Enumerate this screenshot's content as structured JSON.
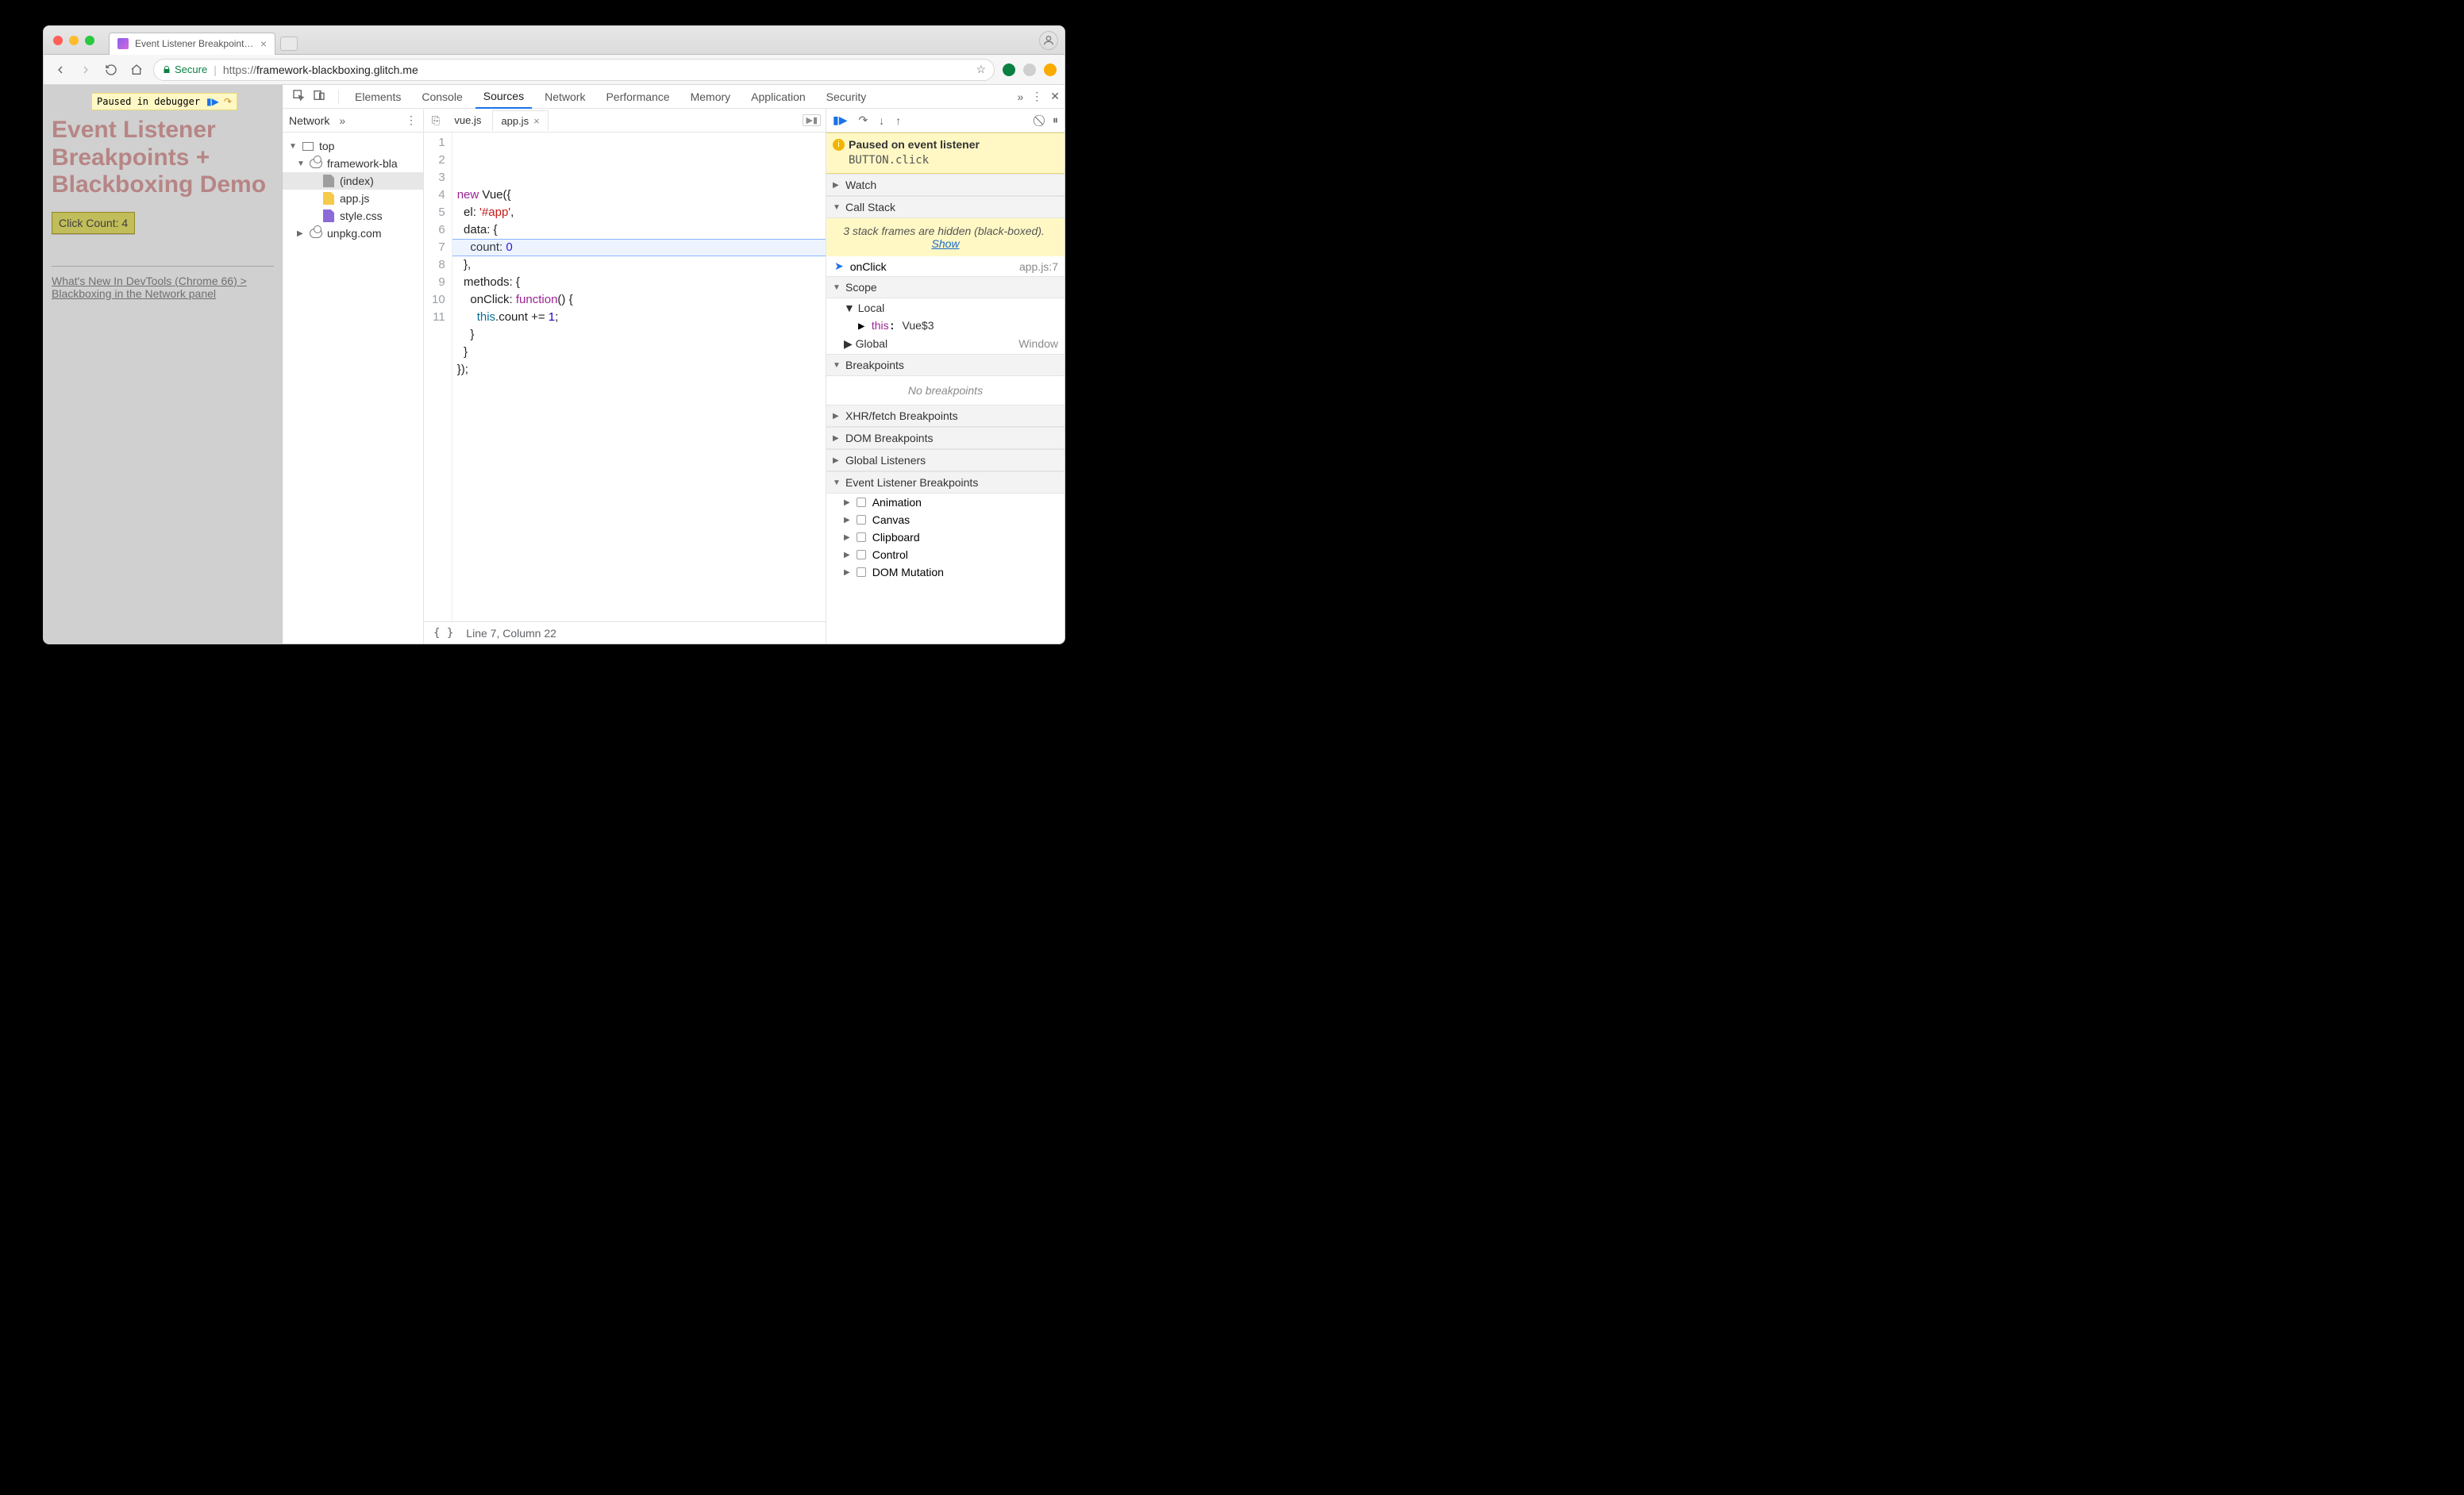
{
  "browser": {
    "tab_title": "Event Listener Breakpoints + B",
    "secure_label": "Secure",
    "url_scheme": "https://",
    "url_host": "framework-blackboxing.glitch.me"
  },
  "page": {
    "paused_label": "Paused in debugger",
    "heading": "Event Listener Breakpoints + Blackboxing Demo",
    "button_label": "Click Count: 4",
    "doc_link": "What's New In DevTools (Chrome 66) > Blackboxing in the Network panel"
  },
  "devtools": {
    "tabs": [
      "Elements",
      "Console",
      "Sources",
      "Network",
      "Performance",
      "Memory",
      "Application",
      "Security"
    ],
    "active_tab": "Sources",
    "navigator": {
      "tab_label": "Network",
      "tree": {
        "top": "top",
        "domain": "framework-bla",
        "files": [
          "(index)",
          "app.js",
          "style.css"
        ],
        "external": "unpkg.com"
      }
    },
    "editor": {
      "open_tabs": [
        "vue.js",
        "app.js"
      ],
      "active_tab": "app.js",
      "highlight_line": 7,
      "code_lines": [
        "new Vue({",
        "  el: '#app',",
        "  data: {",
        "    count: 0",
        "  },",
        "  methods: {",
        "    onClick: function() {",
        "      this.count += 1;",
        "    }",
        "  }",
        "});"
      ],
      "status": "Line 7, Column 22"
    },
    "debugger": {
      "paused_title": "Paused on event listener",
      "paused_detail": "BUTTON.click",
      "sections": {
        "watch": "Watch",
        "callstack": "Call Stack",
        "scope": "Scope",
        "breakpoints": "Breakpoints",
        "xhr": "XHR/fetch Breakpoints",
        "dom": "DOM Breakpoints",
        "global_listeners": "Global Listeners",
        "elb": "Event Listener Breakpoints"
      },
      "hidden_frames_msg": "3 stack frames are hidden (black-boxed).",
      "hidden_frames_link": "Show",
      "frame_name": "onClick",
      "frame_loc": "app.js:7",
      "scope_local": "Local",
      "scope_this_key": "this",
      "scope_this_val": "Vue$3",
      "scope_global": "Global",
      "scope_global_val": "Window",
      "no_breakpoints": "No breakpoints",
      "elb_categories": [
        "Animation",
        "Canvas",
        "Clipboard",
        "Control",
        "DOM Mutation"
      ]
    }
  }
}
